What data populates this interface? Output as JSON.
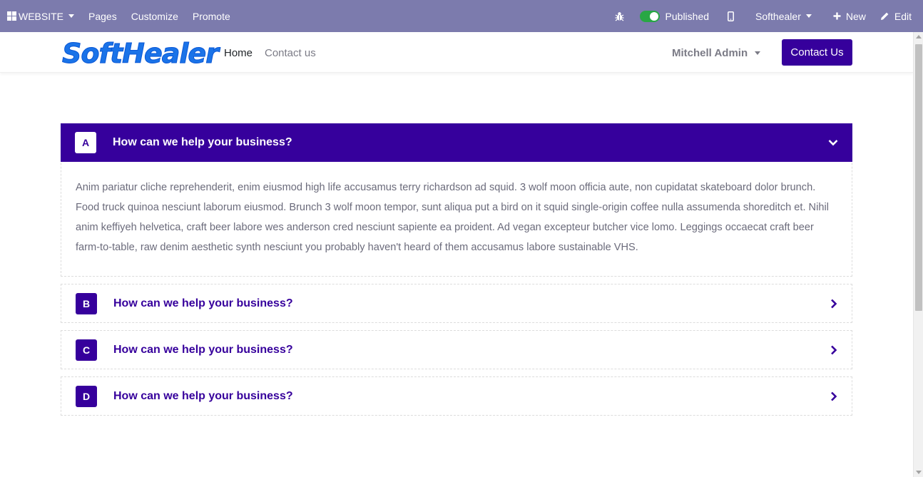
{
  "admin_bar": {
    "apps_label": "WEBSITE",
    "menu": [
      "Pages",
      "Customize",
      "Promote"
    ],
    "published_label": "Published",
    "website_label": "Softhealer",
    "new_label": "New",
    "edit_label": "Edit"
  },
  "header": {
    "logo_text": "SoftHealer",
    "nav": {
      "home": "Home",
      "contact": "Contact us"
    },
    "user_name": "Mitchell Admin",
    "cta_label": "Contact Us"
  },
  "colors": {
    "brand": "#36009c",
    "admin_bar": "#7c7bad",
    "logo": "#1a73e8",
    "published_toggle": "#28a745"
  },
  "accordion": {
    "items": [
      {
        "letter": "A",
        "question": "How can we help your business?",
        "expanded": true,
        "answer": "Anim pariatur cliche reprehenderit, enim eiusmod high life accusamus terry richardson ad squid. 3 wolf moon officia aute, non cupidatat skateboard dolor brunch. Food truck quinoa nesciunt laborum eiusmod. Brunch 3 wolf moon tempor, sunt aliqua put a bird on it squid single-origin coffee nulla assumenda shoreditch et. Nihil anim keffiyeh helvetica, craft beer labore wes anderson cred nesciunt sapiente ea proident. Ad vegan excepteur butcher vice lomo. Leggings occaecat craft beer farm-to-table, raw denim aesthetic synth nesciunt you probably haven't heard of them accusamus labore sustainable VHS."
      },
      {
        "letter": "B",
        "question": "How can we help your business?",
        "expanded": false
      },
      {
        "letter": "C",
        "question": "How can we help your business?",
        "expanded": false
      },
      {
        "letter": "D",
        "question": "How can we help your business?",
        "expanded": false
      }
    ]
  },
  "icons": {
    "apps": "grid-icon",
    "debug": "bug-icon",
    "mobile_preview": "mobile-icon",
    "new": "plus-icon",
    "edit": "pencil-icon",
    "expanded": "chevron-down-icon",
    "collapsed": "chevron-right-icon"
  }
}
